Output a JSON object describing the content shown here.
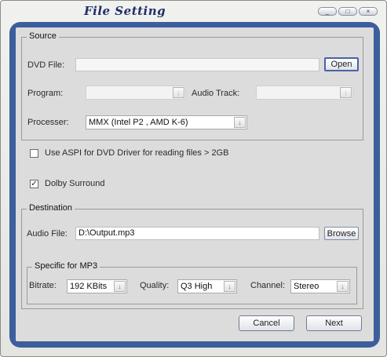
{
  "window": {
    "title": "File Setting",
    "controls": [
      "_",
      "□",
      "×"
    ]
  },
  "source": {
    "legend": "Source",
    "dvd_file_label": "DVD File:",
    "dvd_file_value": "",
    "open_button": "Open",
    "program_label": "Program:",
    "program_value": "",
    "audio_track_label": "Audio Track:",
    "audio_track_value": "",
    "processer_label": "Processer:",
    "processer_value": "MMX (Intel P2 , AMD K-6)"
  },
  "options": {
    "aspi_label": "Use ASPI for DVD Driver for reading files > 2GB",
    "aspi_checked": false,
    "dolby_label": "Dolby Surround",
    "dolby_checked": true,
    "check_mark": "✓"
  },
  "destination": {
    "legend": "Destination",
    "audio_file_label": "Audio File:",
    "audio_file_value": "D:\\Output.mp3",
    "browse_button": "Browse"
  },
  "mp3": {
    "legend": "Specific for MP3",
    "bitrate_label": "Bitrate:",
    "bitrate_value": "192 KBits",
    "quality_label": "Quality:",
    "quality_value": "Q3 High",
    "channel_label": "Channel:",
    "channel_value": "Stereo"
  },
  "footer": {
    "cancel_button": "Cancel",
    "next_button": "Next"
  },
  "icons": {
    "dropdown": "↓"
  }
}
